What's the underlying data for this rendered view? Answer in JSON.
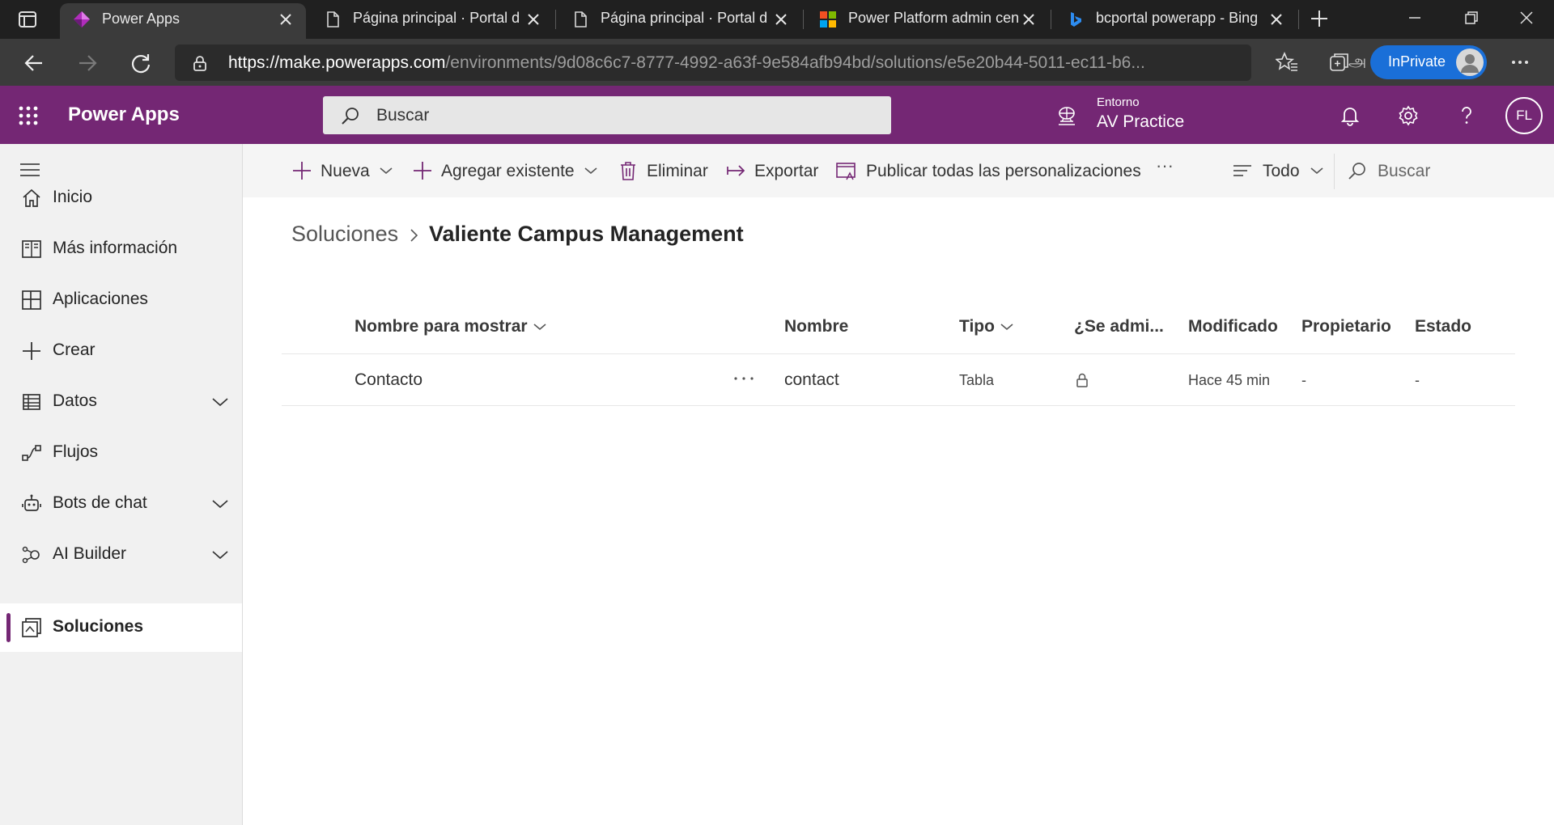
{
  "browser": {
    "tabs": [
      {
        "title": "Power Apps",
        "active": true
      },
      {
        "title": "Página principal  · Portal d"
      },
      {
        "title": "Página principal  · Portal d"
      },
      {
        "title": "Power Platform admin cen"
      },
      {
        "title": "bcportal powerapp - Bing"
      }
    ],
    "url_prefix": "https://",
    "url_host": "make.powerapps.com",
    "url_path": "/environments/9d08c6c7-8777-4992-a63f-9e584afb94bd/solutions/e5e20b44-5011-ec11-b6...",
    "read_aloud_glyph": "அ",
    "inprivate_label": "InPrivate"
  },
  "app": {
    "title": "Power Apps",
    "search_placeholder": "Buscar",
    "environment_label": "Entorno",
    "environment_name": "AV Practice",
    "user_initials": "FL",
    "accent_color": "#742774"
  },
  "sidebar": {
    "items": [
      {
        "label": "Inicio",
        "icon": "home-icon"
      },
      {
        "label": "Más información",
        "icon": "book-icon"
      },
      {
        "label": "Aplicaciones",
        "icon": "apps-icon"
      },
      {
        "label": "Crear",
        "icon": "plus-icon"
      },
      {
        "label": "Datos",
        "icon": "table-icon",
        "expandable": true
      },
      {
        "label": "Flujos",
        "icon": "flow-icon"
      },
      {
        "label": "Bots de chat",
        "icon": "bot-icon",
        "expandable": true
      },
      {
        "label": "AI Builder",
        "icon": "ai-builder-icon",
        "expandable": true
      },
      {
        "label": "Soluciones",
        "icon": "solutions-icon",
        "selected": true
      }
    ]
  },
  "commands": {
    "new": "Nueva",
    "add_existing": "Agregar existente",
    "delete": "Eliminar",
    "export": "Exportar",
    "publish_all": "Publicar todas las personalizaciones",
    "more": "···",
    "filter": "Todo",
    "search": "Buscar"
  },
  "breadcrumb": {
    "root": "Soluciones",
    "current": "Valiente Campus Management"
  },
  "grid": {
    "columns": [
      "Nombre para mostrar",
      "Nombre",
      "Tipo",
      "¿Se admi...",
      "Modificado",
      "Propietario",
      "Estado"
    ],
    "rows": [
      {
        "display_name": "Contacto",
        "name": "contact",
        "type": "Tabla",
        "managed": "lock",
        "modified": "Hace 45 min",
        "owner": "-",
        "status": "-"
      }
    ]
  }
}
